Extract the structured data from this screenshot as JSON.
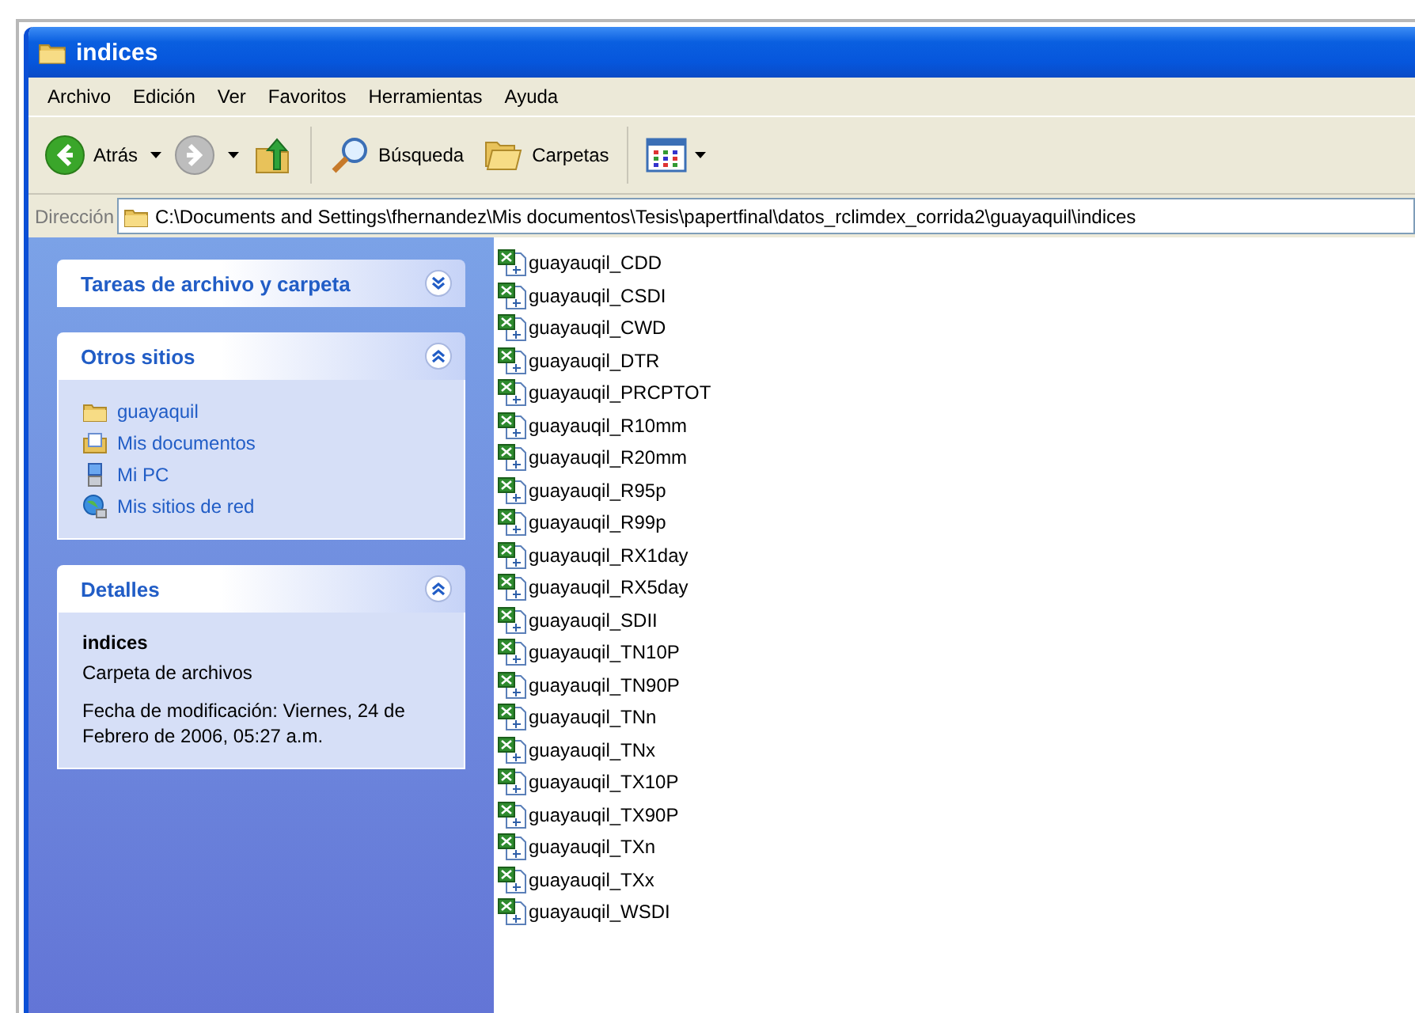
{
  "window": {
    "title": "indices"
  },
  "menu": [
    "Archivo",
    "Edición",
    "Ver",
    "Favoritos",
    "Herramientas",
    "Ayuda"
  ],
  "toolbar": [
    {
      "kind": "back",
      "label": "Atrás",
      "disabled": false
    },
    {
      "kind": "forward",
      "disabled": true
    },
    {
      "kind": "up"
    },
    {
      "kind": "search",
      "label": "Búsqueda"
    },
    {
      "kind": "folders",
      "label": "Carpetas"
    },
    {
      "kind": "views"
    }
  ],
  "address": {
    "label": "Dirección",
    "path": "C:\\Documents and Settings\\fhernandez\\Mis documentos\\Tesis\\papertfinal\\datos_rclimdex_corrida2\\guayaquil\\indices"
  },
  "sidebar": [
    {
      "title": "Tareas de archivo y carpeta",
      "expanded": false
    },
    {
      "kind": "links",
      "title": "Otros sitios",
      "expanded": true,
      "items": [
        {
          "kind": "folder",
          "label": "guayaquil"
        },
        {
          "kind": "documents",
          "label": "Mis documentos"
        },
        {
          "kind": "computer",
          "label": "Mi PC"
        },
        {
          "kind": "network",
          "label": "Mis sitios de red"
        }
      ]
    },
    {
      "kind": "details",
      "title": "Detalles",
      "expanded": true,
      "name": "indices",
      "type": "Carpeta de archivos",
      "modified": "Fecha de modificación: Viernes, 24 de Febrero de 2006, 05:27 a.m."
    }
  ],
  "files": [
    "guayauqil_CDD",
    "guayauqil_CSDI",
    "guayauqil_CWD",
    "guayauqil_DTR",
    "guayauqil_PRCPTOT",
    "guayauqil_R10mm",
    "guayauqil_R20mm",
    "guayauqil_R95p",
    "guayauqil_R99p",
    "guayauqil_RX1day",
    "guayauqil_RX5day",
    "guayauqil_SDII",
    "guayauqil_TN10P",
    "guayauqil_TN90P",
    "guayauqil_TNn",
    "guayauqil_TNx",
    "guayauqil_TX10P",
    "guayauqil_TX90P",
    "guayauqil_TXn",
    "guayauqil_TXx",
    "guayauqil_WSDI"
  ]
}
